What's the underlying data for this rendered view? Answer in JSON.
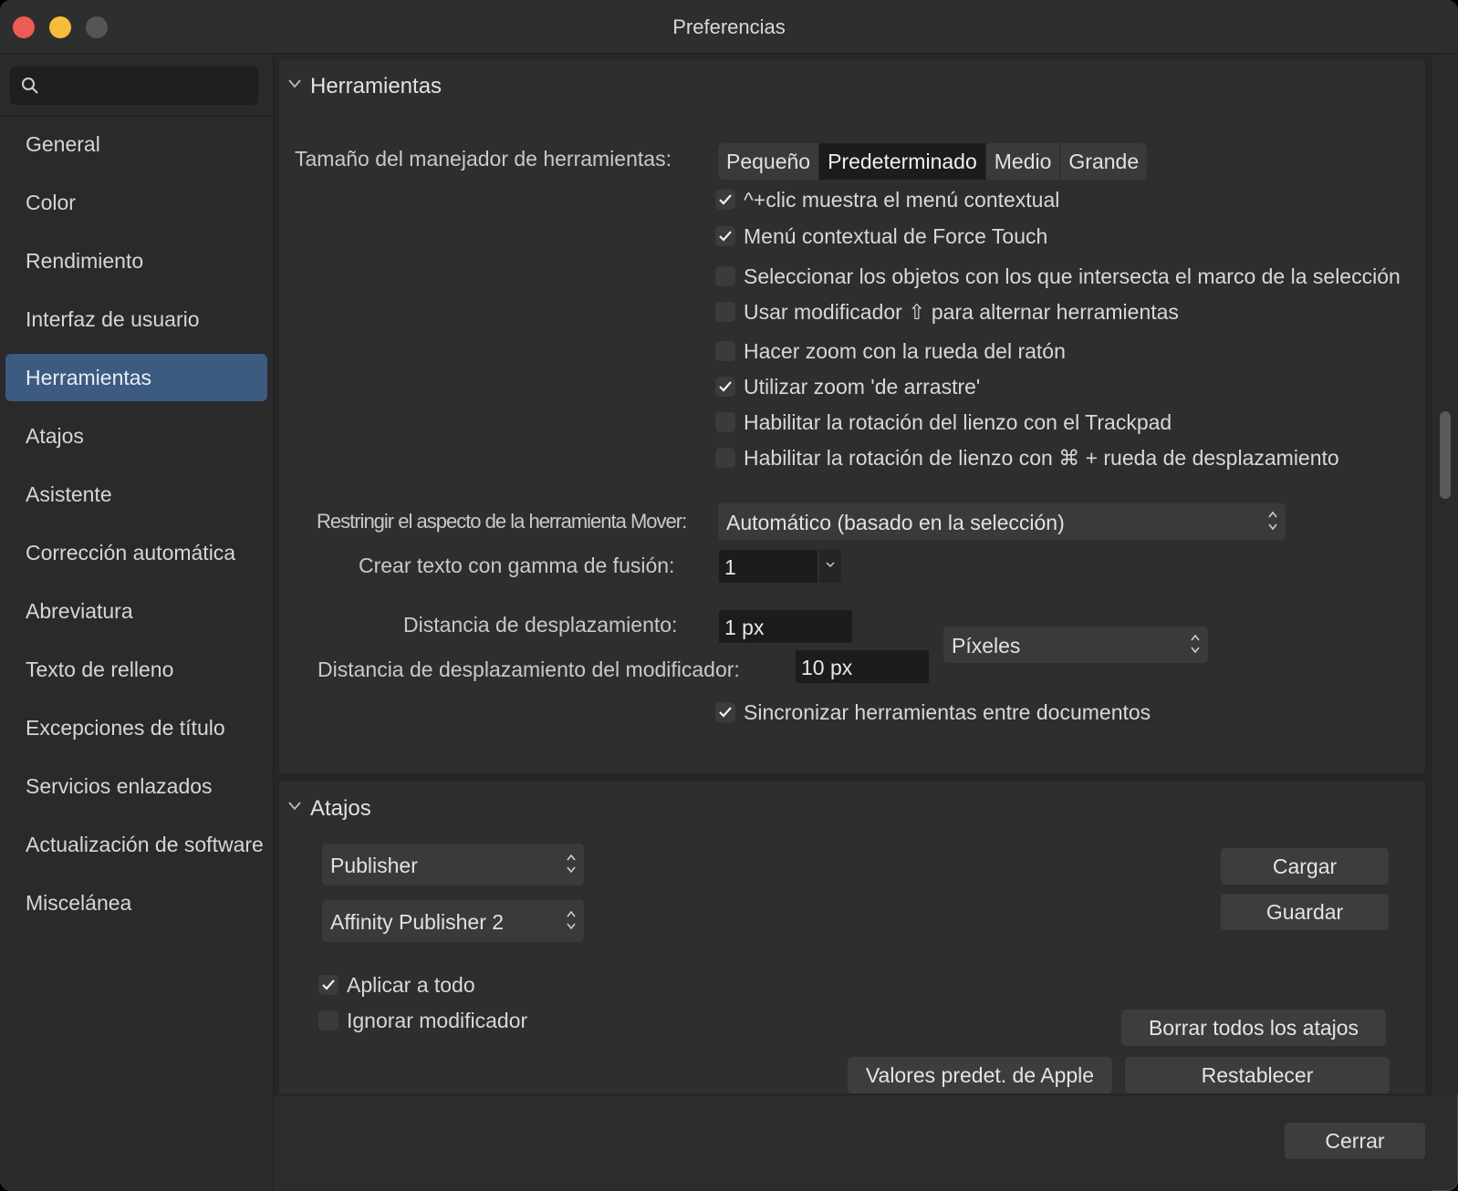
{
  "window": {
    "title": "Preferencias"
  },
  "sidebar": {
    "search_placeholder": "",
    "items": [
      {
        "label": "General"
      },
      {
        "label": "Color"
      },
      {
        "label": "Rendimiento"
      },
      {
        "label": "Interfaz de usuario"
      },
      {
        "label": "Herramientas",
        "active": true
      },
      {
        "label": "Atajos"
      },
      {
        "label": "Asistente"
      },
      {
        "label": "Corrección automática"
      },
      {
        "label": "Abreviatura"
      },
      {
        "label": "Texto de relleno"
      },
      {
        "label": "Excepciones de título"
      },
      {
        "label": "Servicios enlazados"
      },
      {
        "label": "Actualización de software"
      },
      {
        "label": "Miscelánea"
      }
    ]
  },
  "tools": {
    "section_title": "Herramientas",
    "handle_size_label": "Tamaño del manejador de herramientas:",
    "handle_sizes": [
      "Pequeño",
      "Predeterminado",
      "Medio",
      "Grande"
    ],
    "handle_size_selected": "Predeterminado",
    "checkboxes": [
      {
        "label": "^+clic muestra el menú contextual",
        "checked": true
      },
      {
        "label": "Menú contextual de Force Touch",
        "checked": true
      },
      {
        "label": "Seleccionar los objetos con los que intersecta el marco de la selección",
        "checked": false
      },
      {
        "label": "Usar modificador ⇧ para alternar herramientas",
        "checked": false
      },
      {
        "label": "Hacer zoom con la rueda del ratón",
        "checked": false
      },
      {
        "label": "Utilizar zoom 'de arrastre'",
        "checked": true
      },
      {
        "label": "Habilitar la rotación del lienzo con el Trackpad",
        "checked": false
      },
      {
        "label": "Habilitar la rotación de lienzo con ⌘ + rueda de desplazamiento",
        "checked": false
      }
    ],
    "move_aspect_label": "Restringir el aspecto de la herramienta Mover:",
    "move_aspect_value": "Automático (basado en la selección)",
    "blend_gamma_label": "Crear texto con gamma de fusión:",
    "blend_gamma_value": "1",
    "nudge_label": "Distancia de desplazamiento:",
    "nudge_value": "1 px",
    "modifier_nudge_label": "Distancia de desplazamiento del modificador:",
    "modifier_nudge_value": "10 px",
    "units_value": "Píxeles",
    "sync_label": "Sincronizar herramientas entre documentos",
    "sync_checked": true
  },
  "shortcuts": {
    "section_title": "Atajos",
    "app_select": "Publisher",
    "preset_select": "Affinity Publisher 2",
    "load_label": "Cargar",
    "save_label": "Guardar",
    "apply_all_label": "Aplicar a todo",
    "apply_all_checked": true,
    "ignore_modifier_label": "Ignorar modificador",
    "ignore_modifier_checked": false,
    "clear_all_label": "Borrar todos los atajos",
    "apple_defaults_label": "Valores predet. de Apple",
    "reset_label": "Restablecer"
  },
  "footer": {
    "close_label": "Cerrar"
  },
  "colors": {
    "accent": "#3d5a80",
    "close": "#ee5a54",
    "minimize": "#f6bd3b",
    "zoom": "#555555"
  }
}
